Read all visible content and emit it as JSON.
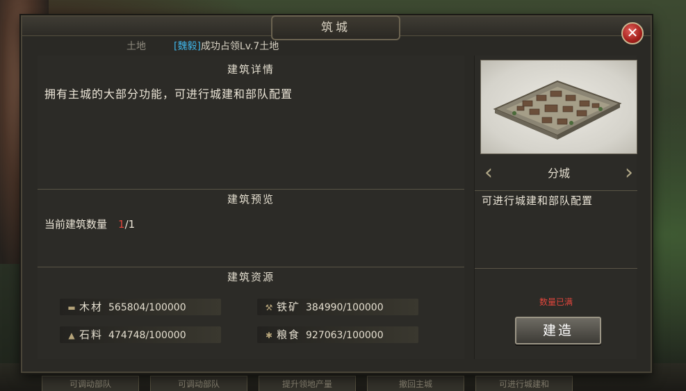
{
  "dialog": {
    "title": "筑城",
    "close_icon": "close-icon"
  },
  "ticker": {
    "prefix": "土地",
    "player": "[魏毅]",
    "message": "成功占领Lv.7土地"
  },
  "details": {
    "heading": "建筑详情",
    "description": "拥有主城的大部分功能，可进行城建和部队配置"
  },
  "preview": {
    "heading": "建筑预览",
    "count_label": "当前建筑数量",
    "count_current": "1",
    "count_total": "/1"
  },
  "resources": {
    "heading": "建筑资源",
    "items": [
      {
        "icon": "wood-icon",
        "label": "木材",
        "value": "565804/100000"
      },
      {
        "icon": "iron-icon",
        "label": "铁矿",
        "value": "384990/100000"
      },
      {
        "icon": "stone-icon",
        "label": "石料",
        "value": "474748/100000"
      },
      {
        "icon": "grain-icon",
        "label": "粮食",
        "value": "927063/100000"
      }
    ]
  },
  "building": {
    "name": "分城",
    "description": "可进行城建和部队配置",
    "status": "数量已满",
    "build_label": "建造"
  },
  "bottom_tabs": [
    "可调动部队",
    "可调动部队",
    "提升领地产量",
    "撤回主城",
    "可进行城建和"
  ],
  "colors": {
    "player_name": "#3fb4e8",
    "warning": "#e0463c"
  }
}
